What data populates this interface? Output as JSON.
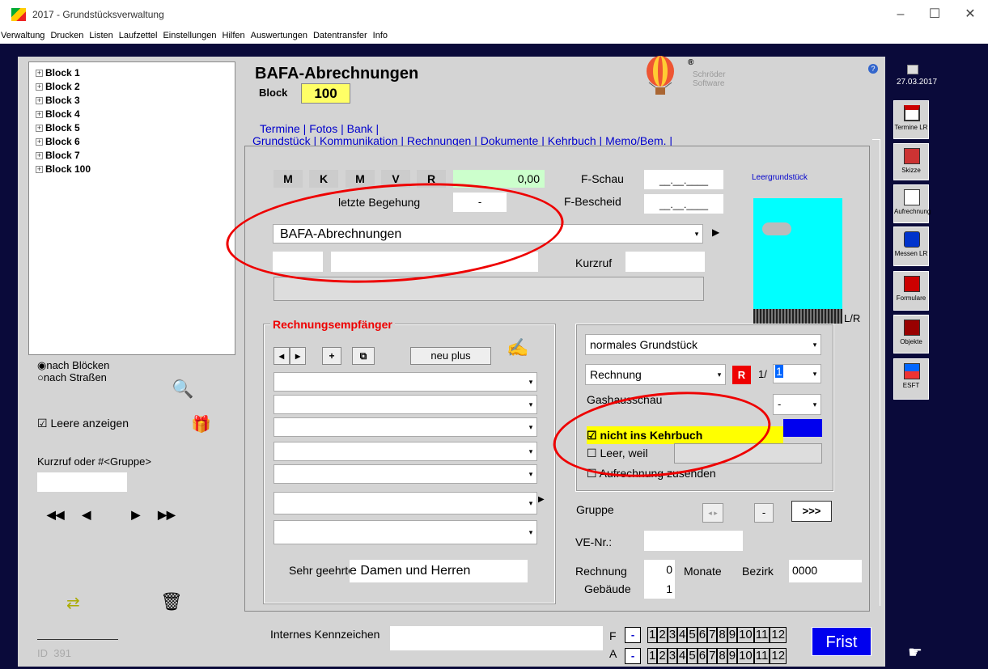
{
  "window": {
    "title": "2017 - Grundstücksverwaltung",
    "min": "–",
    "max": "☐",
    "close": "✕"
  },
  "menu": [
    "Verwaltung",
    "Drucken",
    "Listen",
    "Laufzettel",
    "Einstellungen",
    "Hilfen",
    "Auswertungen",
    "Datentransfer",
    "Info"
  ],
  "tree": [
    "Block 1",
    "Block 2",
    "Block 3",
    "Block 4",
    "Block 5",
    "Block 6",
    "Block 7",
    "Block 100"
  ],
  "left": {
    "radio1": "nach Blöcken",
    "radio2": "nach Straßen",
    "check_label": "Leere anzeigen",
    "kurzruf_label": "Kurzruf oder #<Gruppe>",
    "id_label": "ID",
    "id_value": "391",
    "nav": [
      "◀◀",
      "◀",
      "▶",
      "▶▶"
    ]
  },
  "header": {
    "title": "BAFA-Abrechnungen",
    "block_label": "Block",
    "block_value": "100",
    "logo_line1": "Schröder",
    "logo_line2": "Software",
    "help": "?"
  },
  "tabs_row1": "Termine | Fotos | Bank |",
  "tabs_row2": "Grundstück | Kommunikation | Rechnungen | Dokumente | Kehrbuch | Memo/Bem. |",
  "mk": [
    "M",
    "K",
    "M",
    "V",
    "R"
  ],
  "amount": "0,00",
  "fschau_label": "F-Schau",
  "fschau_value": "__.__.____",
  "fbescheid_label": "F-Bescheid",
  "fbescheid_value": "__.__.____",
  "letzte_label": "letzte Begehung",
  "letzte_value": "-",
  "main_combo": "BAFA-Abrechnungen",
  "kurzruf_label": "Kurzruf",
  "leer_label": "Leergrundstück",
  "lr_label": "L/R",
  "recipients": {
    "title": "Rechnungsempfänger",
    "btn_prev": "◂",
    "btn_next": "▸",
    "btn_plus": "+",
    "btn_copy": "⧉",
    "btn_neu": "neu plus",
    "salutation_label": "Sehr geehrte",
    "salutation_value": "e Damen und Herren"
  },
  "right_box": {
    "type": "normales Grundstück",
    "billing": "Rechnung",
    "r_badge": "R",
    "ratio_prefix": "1/",
    "ratio_value": "1",
    "gas_label": "Gashausschau",
    "gas_value": "-",
    "check1": "nicht ins Kehrbuch",
    "check2": "Leer, weil",
    "check3": "Aufrechnung zusenden"
  },
  "gruppe_label": "Gruppe",
  "gruppe_btn": ">>>",
  "gruppe_minus": "-",
  "ve_label": "VE-Nr.:",
  "rechnung_label": "Rechnung",
  "rechnung_value": "0",
  "monate_label": "Monate",
  "bezirk_label": "Bezirk",
  "bezirk_value": "0000",
  "gebaeude_label": "Gebäude",
  "gebaeude_value": "1",
  "internes_label": "Internes Kennzeichen",
  "f_label": "F",
  "a_label": "A",
  "minus": "-",
  "months": [
    "1",
    "2",
    "3",
    "4",
    "5",
    "6",
    "7",
    "8",
    "9",
    "10",
    "11",
    "12"
  ],
  "frist": "Frist",
  "sidebar": {
    "date": "27.03.2017",
    "items": [
      "Termine LR",
      "Skizze",
      "Aufrechnung",
      "Messen LR",
      "Formulare",
      "Objekte",
      "ESFT"
    ]
  },
  "colors": {
    "accent": "#0000ee",
    "highlight": "#ffff00",
    "ellipse": "#e00000"
  }
}
